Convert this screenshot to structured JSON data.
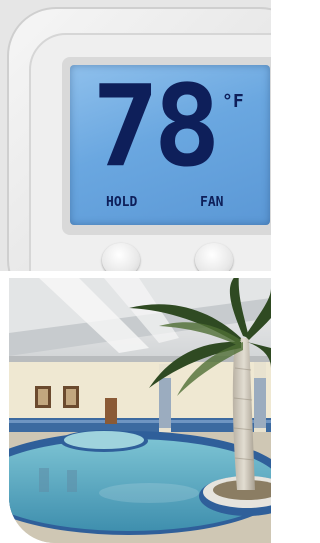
{
  "thermostat": {
    "temperature": "78",
    "unit": "°F",
    "hold_label": "HOLD",
    "fan_label": "FAN"
  },
  "pool_photo": {
    "subject": "indoor-pool"
  },
  "colors": {
    "lcd_background": "#6aa7e0",
    "lcd_text": "#0e1f5a",
    "device_body": "#ececec",
    "pool_water": "#5aa9c0",
    "pool_tile": "#2f5f9a"
  }
}
